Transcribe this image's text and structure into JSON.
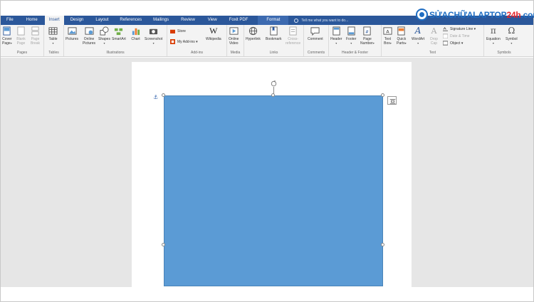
{
  "tabs": [
    {
      "label": "File",
      "active": false
    },
    {
      "label": "Home",
      "active": false
    },
    {
      "label": "Insert",
      "active": true
    },
    {
      "label": "Design",
      "active": false
    },
    {
      "label": "Layout",
      "active": false
    },
    {
      "label": "References",
      "active": false
    },
    {
      "label": "Mailings",
      "active": false
    },
    {
      "label": "Review",
      "active": false
    },
    {
      "label": "View",
      "active": false
    },
    {
      "label": "Foxit PDF",
      "active": false
    }
  ],
  "format_tab": "Format",
  "tell_me": "Tell me what you want to do...",
  "logo": {
    "main": "SỬACHỮALAPTOP",
    "accent": "24h",
    "suffix": ".com"
  },
  "groups": {
    "pages": {
      "label": "Pages",
      "cover_page": [
        "Cover",
        "Page"
      ],
      "blank_page": [
        "Blank",
        "Page"
      ],
      "page_break": [
        "Page",
        "Break"
      ]
    },
    "tables": {
      "label": "Tables",
      "table": "Table"
    },
    "illustrations": {
      "label": "Illustrations",
      "pictures": "Pictures",
      "online_pictures": [
        "Online",
        "Pictures"
      ],
      "shapes": "Shapes",
      "smartart": "SmartArt",
      "chart": "Chart",
      "screenshot": "Screenshot"
    },
    "addins": {
      "label": "Add-ins",
      "store": "Store",
      "my_addins": "My Add-ins",
      "wikipedia": "Wikipedia"
    },
    "media": {
      "label": "Media",
      "online_video": [
        "Online",
        "Video"
      ]
    },
    "links": {
      "label": "Links",
      "hyperlink": "Hyperlink",
      "bookmark": "Bookmark",
      "cross_reference": [
        "Cross-",
        "reference"
      ]
    },
    "comments": {
      "label": "Comments",
      "comment": "Comment"
    },
    "header_footer": {
      "label": "Header & Footer",
      "header": "Header",
      "footer": "Footer",
      "page_number": [
        "Page",
        "Number"
      ]
    },
    "text": {
      "label": "Text",
      "text_box": [
        "Text",
        "Box"
      ],
      "quick_parts": [
        "Quick",
        "Parts"
      ],
      "wordart": "WordArt",
      "drop_cap": [
        "Drop",
        "Cap"
      ],
      "signature_line": "Signature Line",
      "date_time": "Date & Time",
      "object": "Object"
    },
    "symbols": {
      "label": "Symbols",
      "equation": "Equation",
      "symbol": "Symbol"
    }
  },
  "colors": {
    "tabbar": "#2b579a",
    "shape_fill": "#5b9bd5",
    "logo_blue": "#1f6dc2",
    "logo_red": "#e3262d"
  }
}
